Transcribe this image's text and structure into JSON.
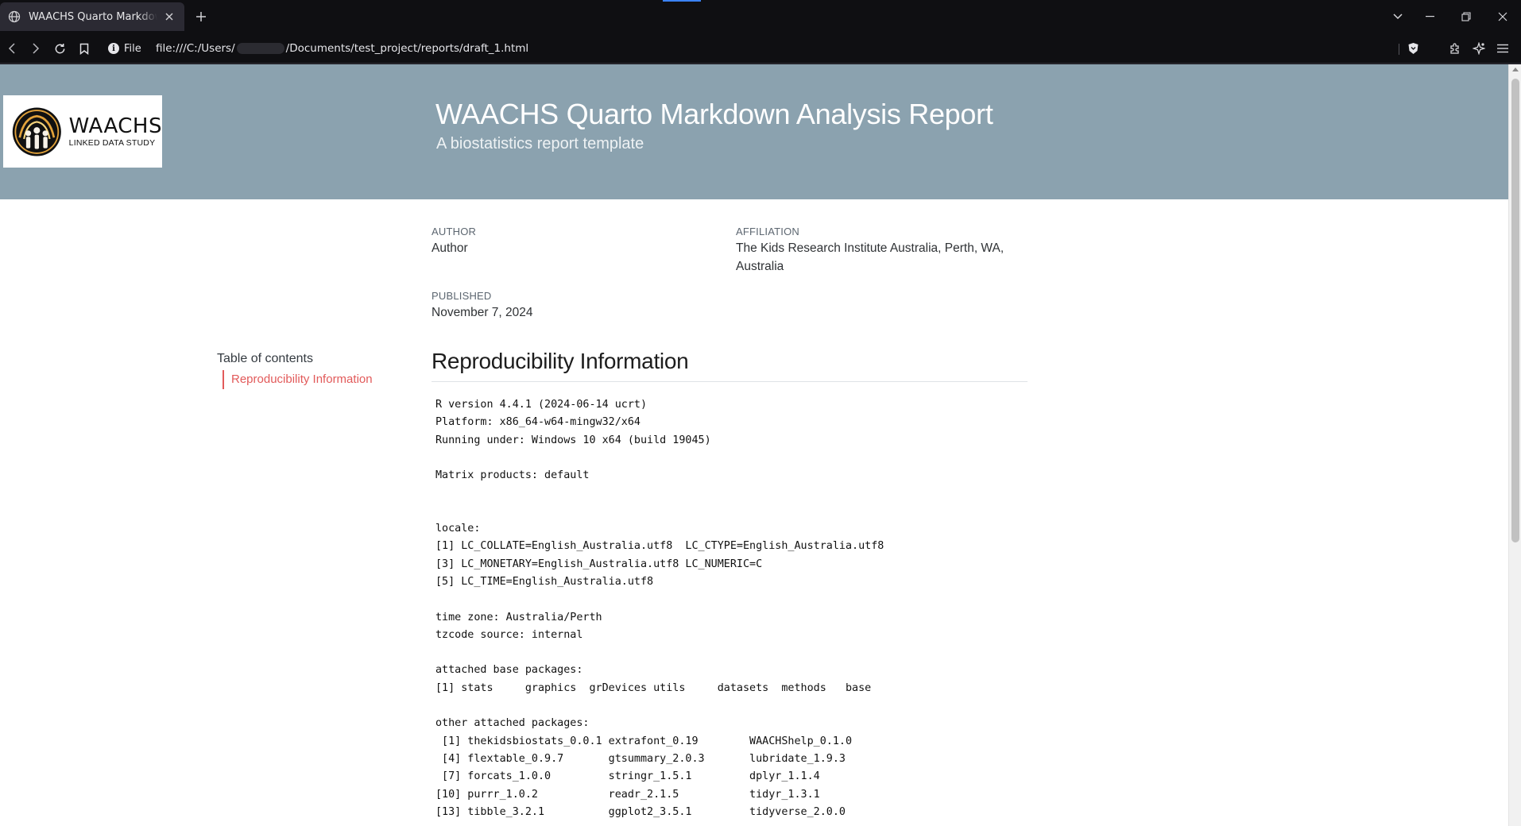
{
  "browser": {
    "tab_title": "WAACHS Quarto Markdown Analysis Report",
    "site_info_label": "File",
    "url_prefix": "file:///C:/Users/",
    "url_suffix": "/Documents/test_project/reports/draft_1.html"
  },
  "page": {
    "logo": {
      "name": "WAACHS",
      "tagline": "LINKED DATA STUDY"
    },
    "title": "WAACHS Quarto Markdown Analysis Report",
    "subtitle": "A biostatistics report template",
    "meta": {
      "author_label": "AUTHOR",
      "author_value": "Author",
      "affiliation_label": "AFFILIATION",
      "affiliation_line1": "The Kids Research Institute Australia, Perth, WA,",
      "affiliation_line2": "Australia",
      "published_label": "PUBLISHED",
      "published_value": "November 7, 2024"
    },
    "toc": {
      "title": "Table of contents",
      "items": [
        {
          "label": "Reproducibility Information"
        }
      ]
    },
    "section_title": "Reproducibility Information",
    "code_lines": [
      "R version 4.4.1 (2024-06-14 ucrt)",
      "Platform: x86_64-w64-mingw32/x64",
      "Running under: Windows 10 x64 (build 19045)",
      "",
      "Matrix products: default",
      "",
      "",
      "locale:",
      "[1] LC_COLLATE=English_Australia.utf8  LC_CTYPE=English_Australia.utf8",
      "[3] LC_MONETARY=English_Australia.utf8 LC_NUMERIC=C",
      "[5] LC_TIME=English_Australia.utf8",
      "",
      "time zone: Australia/Perth",
      "tzcode source: internal",
      "",
      "attached base packages:",
      "[1] stats     graphics  grDevices utils     datasets  methods   base",
      "",
      "other attached packages:",
      " [1] thekidsbiostats_0.0.1 extrafont_0.19        WAACHShelp_0.1.0",
      " [4] flextable_0.9.7       gtsummary_2.0.3       lubridate_1.9.3",
      " [7] forcats_1.0.0         stringr_1.5.1         dplyr_1.1.4",
      "[10] purrr_1.0.2           readr_2.1.5           tidyr_1.3.1",
      "[13] tibble_3.2.1          ggplot2_3.5.1         tidyverse_2.0.0"
    ]
  },
  "colors": {
    "banner": "#8ba2af",
    "toc_accent": "#e25a5a",
    "browser_bg": "#0f0f12"
  }
}
